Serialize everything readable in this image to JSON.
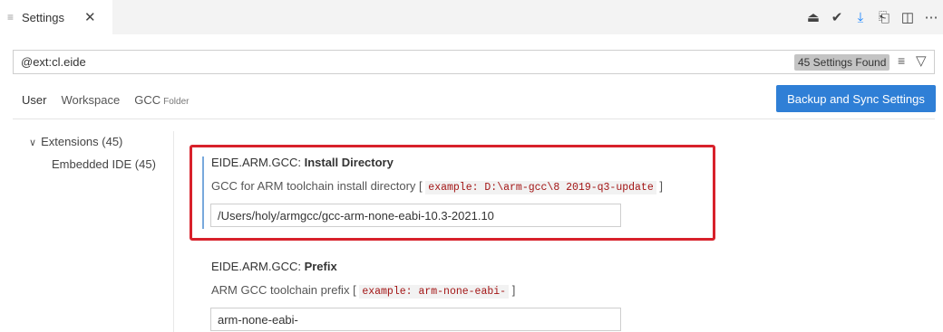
{
  "tab": {
    "title": "Settings",
    "close_glyph": "✕",
    "menu_glyph": "≡"
  },
  "toolbar": {
    "icons": [
      {
        "name": "settings-sync-icon",
        "glyph": "⏏"
      },
      {
        "name": "clean-brush-icon",
        "glyph": "✔"
      },
      {
        "name": "download-icon",
        "glyph": "⤓"
      },
      {
        "name": "open-json-icon",
        "glyph": "⎗"
      },
      {
        "name": "split-editor-icon",
        "glyph": "◫"
      },
      {
        "name": "more-actions-icon",
        "glyph": "⋯"
      }
    ]
  },
  "search": {
    "value": "@ext:cl.eide",
    "results_badge": "45 Settings Found",
    "clear_glyph": "≡",
    "filter_glyph": "▽"
  },
  "scopes": {
    "user": "User",
    "workspace": "Workspace",
    "folder": "GCC",
    "folder_sub": "Folder"
  },
  "sync_button": "Backup and Sync Settings",
  "tree": {
    "chevron": "∨",
    "extensions": "Extensions (45)",
    "embedded_ide": "Embedded IDE (45)"
  },
  "settings": [
    {
      "title_prefix": "EIDE.ARM.GCC: ",
      "title_name": "Install Directory",
      "description": "GCC for ARM toolchain install directory",
      "example": "example: D:\\arm-gcc\\8 2019-q3-update",
      "value": "/Users/holy/armgcc/gcc-arm-none-eabi-10.3-2021.10"
    },
    {
      "title_prefix": "EIDE.ARM.GCC: ",
      "title_name": "Prefix",
      "description": "ARM GCC toolchain prefix",
      "example": "example: arm-none-eabi-",
      "value": "arm-none-eabi-"
    }
  ],
  "bracket_open": "[",
  "bracket_close": "]"
}
